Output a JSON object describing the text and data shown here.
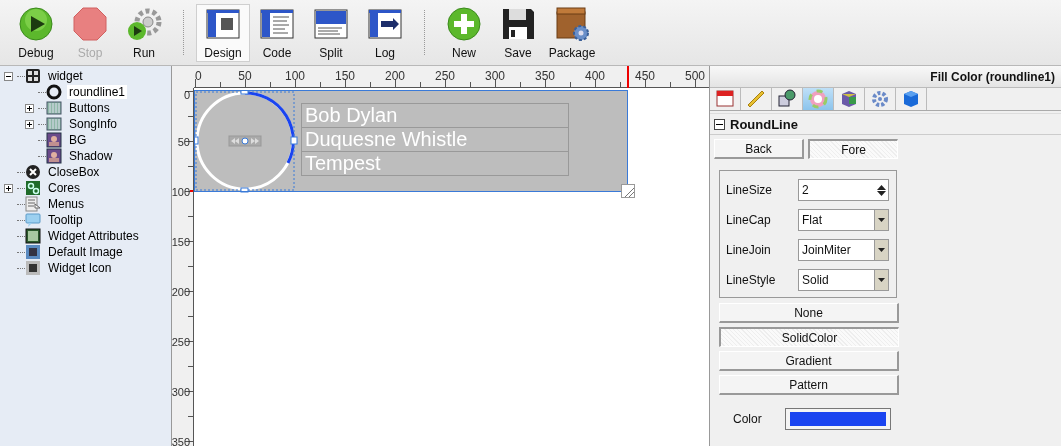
{
  "toolbar": {
    "groups": [
      {
        "items": [
          {
            "label": "Debug",
            "disabled": false,
            "selected": false
          },
          {
            "label": "Stop",
            "disabled": true,
            "selected": false
          },
          {
            "label": "Run",
            "disabled": false,
            "selected": false
          }
        ]
      },
      {
        "items": [
          {
            "label": "Design",
            "disabled": false,
            "selected": true
          },
          {
            "label": "Code",
            "disabled": false,
            "selected": false
          },
          {
            "label": "Split",
            "disabled": false,
            "selected": false
          },
          {
            "label": "Log",
            "disabled": false,
            "selected": false
          }
        ]
      },
      {
        "items": [
          {
            "label": "New",
            "disabled": false,
            "selected": false
          },
          {
            "label": "Save",
            "disabled": false,
            "selected": false
          },
          {
            "label": "Package",
            "disabled": false,
            "selected": false
          }
        ]
      }
    ]
  },
  "tree": {
    "items": [
      {
        "label": "widget",
        "expanded": true,
        "selected": false,
        "children": [
          {
            "label": "roundline1",
            "selected": true
          },
          {
            "label": "Buttons",
            "expanded": false,
            "selected": false
          },
          {
            "label": "SongInfo",
            "expanded": false,
            "selected": false
          },
          {
            "label": "BG",
            "selected": false
          },
          {
            "label": "Shadow",
            "selected": false
          }
        ]
      },
      {
        "label": "CloseBox",
        "selected": false
      },
      {
        "label": "Cores",
        "expanded": false,
        "selected": false
      },
      {
        "label": "Menus",
        "selected": false
      },
      {
        "label": "Tooltip",
        "selected": false
      },
      {
        "label": "Widget Attributes",
        "selected": false
      },
      {
        "label": "Default Image",
        "selected": false
      },
      {
        "label": "Widget Icon",
        "selected": false
      }
    ]
  },
  "ruler": {
    "x_labels": [
      "0",
      "50",
      "100",
      "150",
      "200",
      "250",
      "300",
      "350",
      "400",
      "450",
      "500"
    ],
    "y_labels": [
      "0",
      "50",
      "100",
      "150",
      "200",
      "250",
      "300",
      "350"
    ]
  },
  "canvas": {
    "lines": [
      "Bob Dylan",
      "Duquesne Whistle",
      "Tempest"
    ]
  },
  "properties": {
    "title": "Fill Color (roundline1)",
    "tabs": [
      {
        "selected": false
      },
      {
        "selected": false
      },
      {
        "selected": false
      },
      {
        "selected": true
      },
      {
        "selected": false
      },
      {
        "selected": false
      },
      {
        "selected": false
      }
    ],
    "section": {
      "title": "RoundLine",
      "expanded": true
    },
    "sides": [
      {
        "label": "Back",
        "selected": false
      },
      {
        "label": "Fore",
        "selected": true
      }
    ],
    "fields": [
      {
        "kind": "spin",
        "label": "LineSize",
        "value": "2"
      },
      {
        "kind": "select",
        "label": "LineCap",
        "value": "Flat"
      },
      {
        "kind": "select",
        "label": "LineJoin",
        "value": "JoinMiter"
      },
      {
        "kind": "select",
        "label": "LineStyle",
        "value": "Solid"
      }
    ],
    "fill_types": [
      {
        "label": "None",
        "selected": false
      },
      {
        "label": "SolidColor",
        "selected": true
      },
      {
        "label": "Gradient",
        "selected": false
      },
      {
        "label": "Pattern",
        "selected": false
      }
    ],
    "color": {
      "label": "Color",
      "color": "#1a44f0"
    }
  }
}
